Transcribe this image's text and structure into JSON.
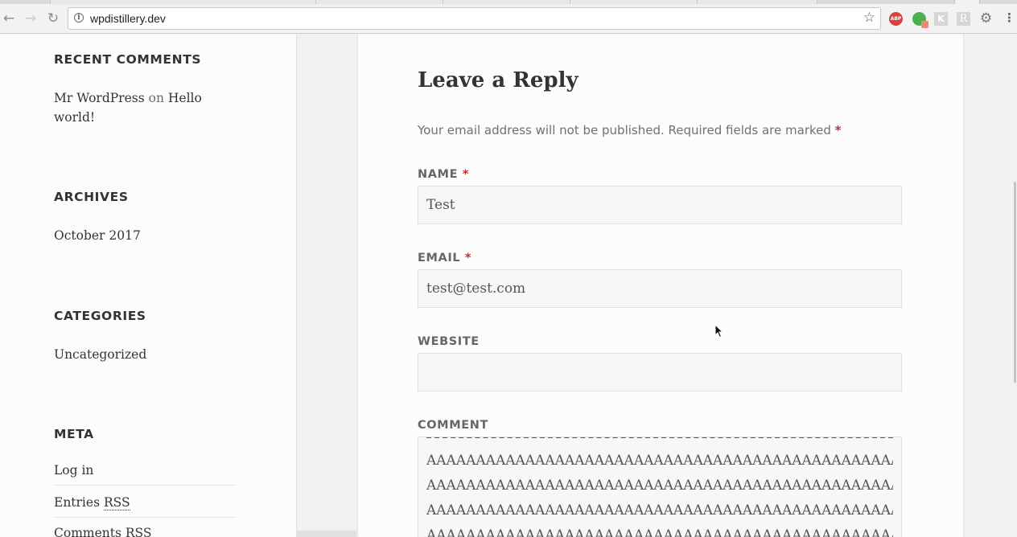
{
  "browser": {
    "url": "wpdistillery.dev",
    "icons": {
      "back": "arrow-left-icon",
      "forward": "arrow-right-icon",
      "reload": "reload-icon",
      "info": "info-icon",
      "bookmark": "star-icon"
    },
    "extensions": [
      {
        "name": "adblock-plus",
        "label": "ABP"
      },
      {
        "name": "green-extension",
        "label": ""
      },
      {
        "name": "k-extension",
        "label": "K"
      },
      {
        "name": "r-extension",
        "label": "R"
      },
      {
        "name": "gear-extension",
        "label": "⚙"
      }
    ]
  },
  "sidebar": {
    "recent_comments": {
      "title": "RECENT COMMENTS",
      "author": "Mr WordPress",
      "on": "on",
      "post": "Hello world!"
    },
    "archives": {
      "title": "ARCHIVES",
      "items": [
        "October 2017"
      ]
    },
    "categories": {
      "title": "CATEGORIES",
      "items": [
        "Uncategorized"
      ]
    },
    "meta": {
      "title": "META",
      "log_in": "Log in",
      "entries_prefix": "Entries",
      "comments_prefix": "Comments",
      "rss": "RSS"
    }
  },
  "reply_form": {
    "title": "Leave a Reply",
    "notes": "Your email address will not be published. Required fields are marked",
    "required_mark": "*",
    "name": {
      "label": "NAME",
      "value": "Test"
    },
    "email": {
      "label": "EMAIL",
      "value": "test@test.com"
    },
    "website": {
      "label": "WEBSITE",
      "value": ""
    },
    "comment": {
      "label": "COMMENT",
      "lines": [
        "AAAAAAAAAAAAAAAAAAAAAAAAAAAAAAAAAAAAAAAAAAAAAAAAAAAAAA",
        "AAAAAAAAAAAAAAAAAAAAAAAAAAAAAAAAAAAAAAAAAAAAAAAAAAAAAA",
        "AAAAAAAAAAAAAAAAAAAAAAAAAAAAAAAAAAAAAAAAAAAAAAAAAAAAAA",
        "AAAAAAAAAAAAAAAAAAAAAAAAAAAAAAAAAAAAAAAAAAAAAAAAAAAAAA"
      ]
    }
  },
  "colors": {
    "required": "#bb3333",
    "text": "#333333",
    "muted": "#707070"
  }
}
